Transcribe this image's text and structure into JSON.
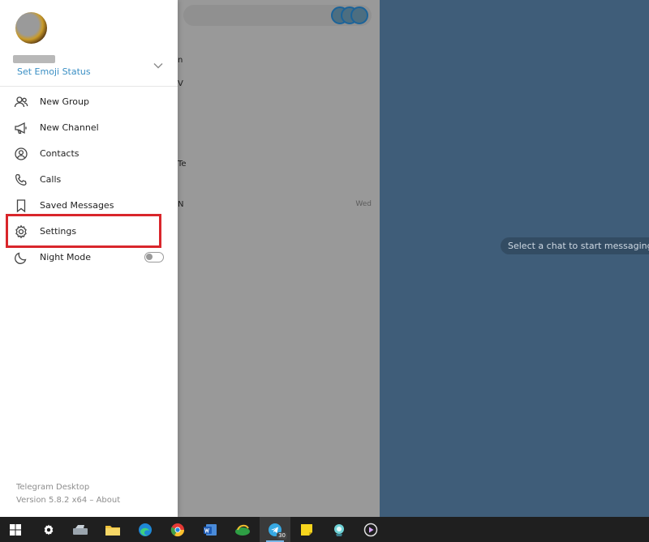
{
  "window": {
    "empty_state": "Select a chat to start messaging"
  },
  "drawer": {
    "emoji_status": "Set Emoji Status",
    "menu": [
      {
        "label": "New Group",
        "icon": "users-icon"
      },
      {
        "label": "New Channel",
        "icon": "megaphone-icon"
      },
      {
        "label": "Contacts",
        "icon": "contact-icon"
      },
      {
        "label": "Calls",
        "icon": "phone-icon"
      },
      {
        "label": "Saved Messages",
        "icon": "bookmark-icon"
      },
      {
        "label": "Settings",
        "icon": "gear-icon"
      },
      {
        "label": "Night Mode",
        "icon": "moon-icon"
      }
    ],
    "night_mode_on": false,
    "footer": {
      "app_name": "Telegram Desktop",
      "version": "Version 5.8.2 x64 – About"
    }
  },
  "chatlist_fragments": [
    {
      "frag": "n",
      "time": ""
    },
    {
      "frag": "V",
      "time": ""
    },
    {
      "frag": "Te",
      "time": ""
    },
    {
      "frag": "N",
      "time": "Wed"
    }
  ],
  "taskbar": {
    "icons": [
      "windows-start-icon",
      "settings-icon",
      "scanner-icon",
      "file-explorer-icon",
      "edge-icon",
      "chrome-icon",
      "word-icon",
      "download-manager-icon",
      "telegram-icon",
      "sticky-notes-icon",
      "maps-icon",
      "media-player-icon"
    ],
    "telegram_badge": "30"
  },
  "colors": {
    "accent": "#3a8fc4",
    "highlight": "#d9262b",
    "panel": "#3f5d79",
    "taskbar": "#1f1f1f"
  }
}
